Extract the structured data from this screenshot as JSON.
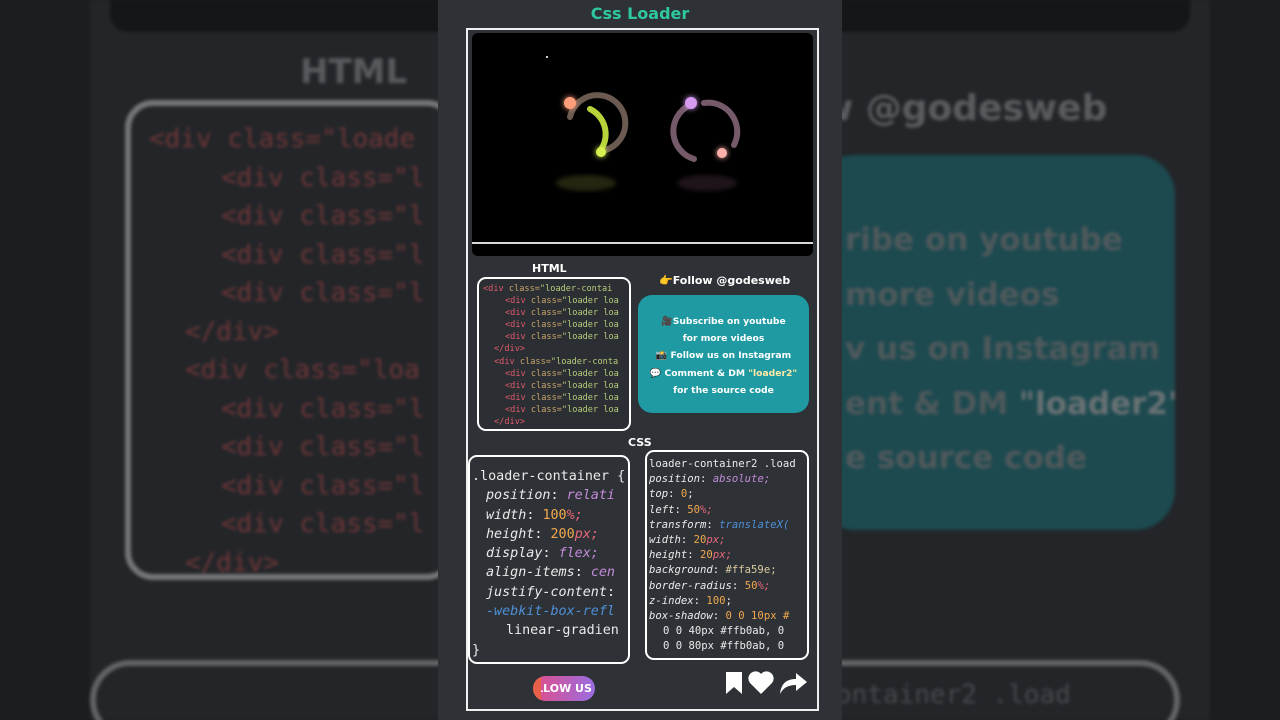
{
  "background": {
    "html_title": "HTML",
    "code_lines": [
      "<div class=\"loade",
      "<div class=\"l",
      "<div class=\"l",
      "<div class=\"l",
      "<div class=\"l",
      "</div>",
      "<div class=\"loa",
      "<div class=\"l",
      "<div class=\"l",
      "<div class=\"l",
      "<div class=\"l",
      "</div>"
    ],
    "follow_text": "w @godesweb",
    "panel_lines": [
      "ribe on youtube",
      "more videos",
      "v us on Instagram",
      "ent & DM ",
      "e source code"
    ],
    "panel_quote": "\"loader2\"",
    "bottom_code": "ontainer2 .load"
  },
  "phone": {
    "title": "Css Loader",
    "html_label": "HTML",
    "css_label": "CSS",
    "html_code": [
      {
        "indent": 0,
        "tag": "<div",
        "attr": " class=",
        "val": "\"loader-contai"
      },
      {
        "indent": 1,
        "tag": "<div",
        "attr": " class=",
        "val": "\"loader loa"
      },
      {
        "indent": 1,
        "tag": "<div",
        "attr": " class=",
        "val": "\"loader loa"
      },
      {
        "indent": 1,
        "tag": "<div",
        "attr": " class=",
        "val": "\"loader loa"
      },
      {
        "indent": 1,
        "tag": "<div",
        "attr": " class=",
        "val": "\"loader loa"
      },
      {
        "indent": 0.5,
        "tag": "</div>",
        "attr": "",
        "val": ""
      },
      {
        "indent": 0.5,
        "tag": "<div",
        "attr": " class=",
        "val": "\"loader-conta"
      },
      {
        "indent": 1,
        "tag": "<div",
        "attr": " class=",
        "val": "\"loader loa"
      },
      {
        "indent": 1,
        "tag": "<div",
        "attr": " class=",
        "val": "\"loader loa"
      },
      {
        "indent": 1,
        "tag": "<div",
        "attr": " class=",
        "val": "\"loader loa"
      },
      {
        "indent": 1,
        "tag": "<div",
        "attr": " class=",
        "val": "\"loader loa"
      },
      {
        "indent": 0.5,
        "tag": "</div>",
        "attr": "",
        "val": ""
      }
    ],
    "follow_handle": "👉Follow @godesweb",
    "cta_lines": [
      "🎥Subscribe on youtube",
      "for more videos",
      "📸 Follow us on Instagram",
      "💬 Comment & DM ",
      "for the source code"
    ],
    "cta_quote": "\"loader2\"",
    "css_left": {
      "selector": ".loader-container {",
      "lines": [
        {
          "prop": "position",
          "val": "relati",
          "kind": "kw"
        },
        {
          "prop": "width",
          "num": "100",
          "unit": "%;",
          "kind": "num"
        },
        {
          "prop": "height",
          "num": "200",
          "unit": "px;",
          "kind": "num"
        },
        {
          "prop": "display",
          "val": "flex;",
          "kind": "kw"
        },
        {
          "prop": "align-items",
          "val": "cen",
          "kind": "kw"
        },
        {
          "prop": "justify-content",
          "val": "",
          "kind": "kw"
        },
        {
          "prop": "-webkit-box-refl",
          "val": "",
          "kind": "vendor"
        }
      ],
      "gradient": "linear-gradien",
      "close": "}"
    },
    "css_right": {
      "selector": "loader-container2 .load",
      "lines": [
        {
          "prop": "position",
          "val": "absolute;",
          "kind": "kw"
        },
        {
          "prop": "top",
          "num": "0",
          "unit": ";",
          "kind": "num"
        },
        {
          "prop": "left",
          "num": "50",
          "unit": "%;",
          "kind": "num"
        },
        {
          "prop": "transform",
          "val": "translateX(",
          "kind": "fn"
        },
        {
          "prop": "width",
          "num": "20",
          "unit": "px;",
          "kind": "num"
        },
        {
          "prop": "height",
          "num": "20",
          "unit": "px;",
          "kind": "num"
        },
        {
          "prop": "background",
          "val": "#ffa59e;",
          "kind": "hex"
        },
        {
          "prop": "border-radius",
          "num": "50",
          "unit": "%;",
          "kind": "num"
        },
        {
          "prop": "z-index",
          "num": "100",
          "unit": ";",
          "kind": "num"
        },
        {
          "prop": "box-shadow",
          "val": "0 0 10px #",
          "kind": "shadow"
        }
      ],
      "shadow_lines": [
        "0 0 40px #ffb0ab, 0",
        "0 0 80px #ffb0ab, 0"
      ]
    },
    "follow_button": "LLOW US",
    "icons": [
      "bookmark-icon",
      "heart-icon",
      "share-icon"
    ]
  },
  "colors": {
    "accent": "#2ec8a0",
    "panel": "#1f9aa2",
    "loader_left": "#c6e33a",
    "loader_left_glow": "#ff9e7a",
    "loader_right": "#c27ad8",
    "loader_right_glow": "#ffb0ab"
  }
}
